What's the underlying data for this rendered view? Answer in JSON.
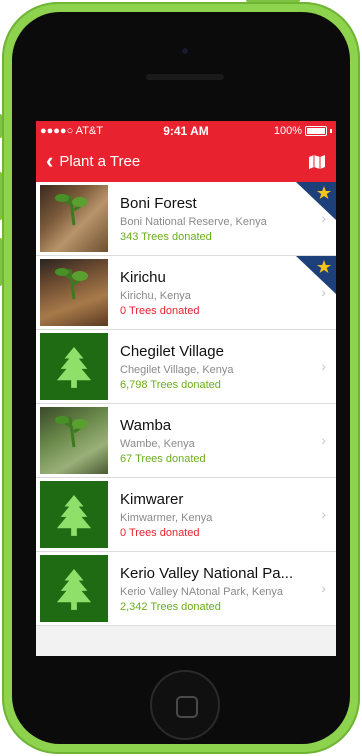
{
  "status_bar": {
    "carrier": "●●●●○ AT&T",
    "time": "9:41 AM",
    "battery": "100%"
  },
  "nav": {
    "back_label": "Plant a Tree"
  },
  "colors": {
    "brand_red": "#e8232f",
    "green_count": "#6aae1c",
    "tree_bg": "#1e6b14",
    "ribbon_blue": "#1d3f7a",
    "star": "#f5c518"
  },
  "projects": [
    {
      "name": "Boni Forest",
      "location": "Boni National Reserve, Kenya",
      "donated": "343 Trees donated",
      "featured": true
    },
    {
      "name": "Kirichu",
      "location": "Kirichu, Kenya",
      "donated": "0 Trees donated",
      "featured": true
    },
    {
      "name": "Chegilet Village",
      "location": "Chegilet Village, Kenya",
      "donated": "6,798 Trees donated",
      "featured": false
    },
    {
      "name": "Wamba",
      "location": "Wambe, Kenya",
      "donated": "67 Trees donated",
      "featured": false
    },
    {
      "name": "Kimwarer",
      "location": "Kimwarmer, Kenya",
      "donated": "0 Trees donated",
      "featured": false
    },
    {
      "name": "Kerio Valley National Pa...",
      "location": "Kerio Valley NAtonal Park, Kenya",
      "donated": "2,342 Trees donated",
      "featured": false
    }
  ],
  "icons": {
    "back": "chevron-left-icon",
    "map": "map-icon",
    "row_chevron": "chevron-right-icon",
    "tree": "tree-icon",
    "star": "star-icon"
  }
}
